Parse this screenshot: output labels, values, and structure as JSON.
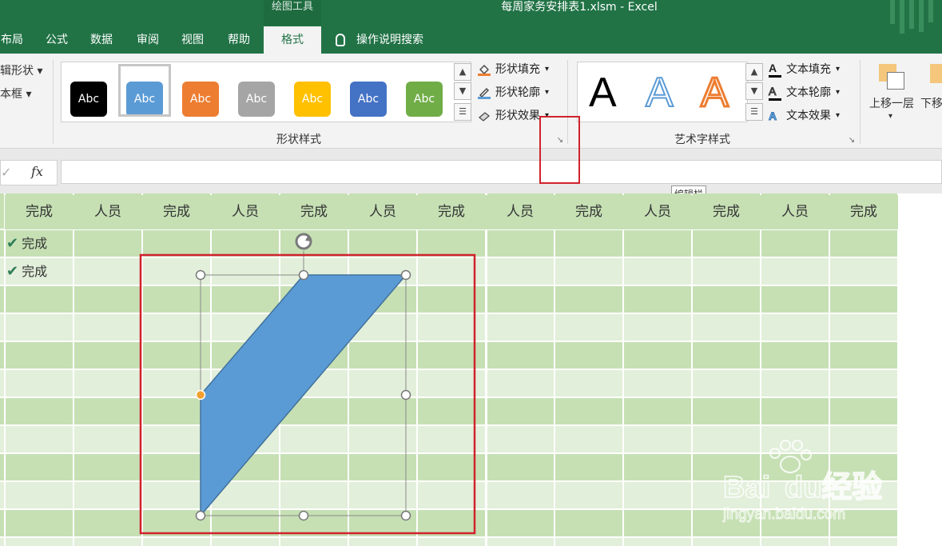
{
  "app": {
    "contextual_group": "绘图工具",
    "title": "每周家务安排表1.xlsm  -  Excel"
  },
  "tabs": [
    {
      "label": "布局"
    },
    {
      "label": "公式"
    },
    {
      "label": "数据"
    },
    {
      "label": "审阅"
    },
    {
      "label": "视图"
    },
    {
      "label": "帮助"
    },
    {
      "label": "格式",
      "active": true
    }
  ],
  "tell_me": "操作说明搜索",
  "ribbon": {
    "insert_shapes": {
      "edit_shape": "编辑形状",
      "text_box": "文本框"
    },
    "shape_styles": {
      "label": "形状样式",
      "swatches": [
        {
          "text": "Abc",
          "color": "#000000"
        },
        {
          "text": "Abc",
          "color": "#5b9bd5"
        },
        {
          "text": "Abc",
          "color": "#ed7d31"
        },
        {
          "text": "Abc",
          "color": "#a5a5a5"
        },
        {
          "text": "Abc",
          "color": "#ffc000"
        },
        {
          "text": "Abc",
          "color": "#4472c4"
        },
        {
          "text": "Abc",
          "color": "#70ad47"
        }
      ],
      "fill": "形状填充",
      "outline": "形状轮廓",
      "effects": "形状效果"
    },
    "wordart_styles": {
      "label": "艺术字样式",
      "samples": [
        "A",
        "A",
        "A"
      ],
      "text_fill": "文本填充",
      "text_outline": "文本轮廓",
      "text_effects": "文本效果"
    },
    "arrange": {
      "bring_forward": "上移一层",
      "send_backward": "下移"
    }
  },
  "formula_bar": {
    "fx": "fx",
    "value": "",
    "tooltip": "编辑栏"
  },
  "sheet": {
    "headers": [
      "完成",
      "人员",
      "完成",
      "人员",
      "完成",
      "人员",
      "完成",
      "人员",
      "完成",
      "人员",
      "完成",
      "人员",
      "完成"
    ],
    "done_rows": [
      "完成",
      "完成"
    ]
  },
  "colors": {
    "excel_green": "#217346",
    "header_fill": "#c6e0b4",
    "band_dark": "#c6e0b4",
    "band_light": "#e2efda",
    "shape_fill": "#5b9bd5",
    "highlight": "#d0222c"
  },
  "watermark": "Baidu经验 jingyan.baidu.com"
}
